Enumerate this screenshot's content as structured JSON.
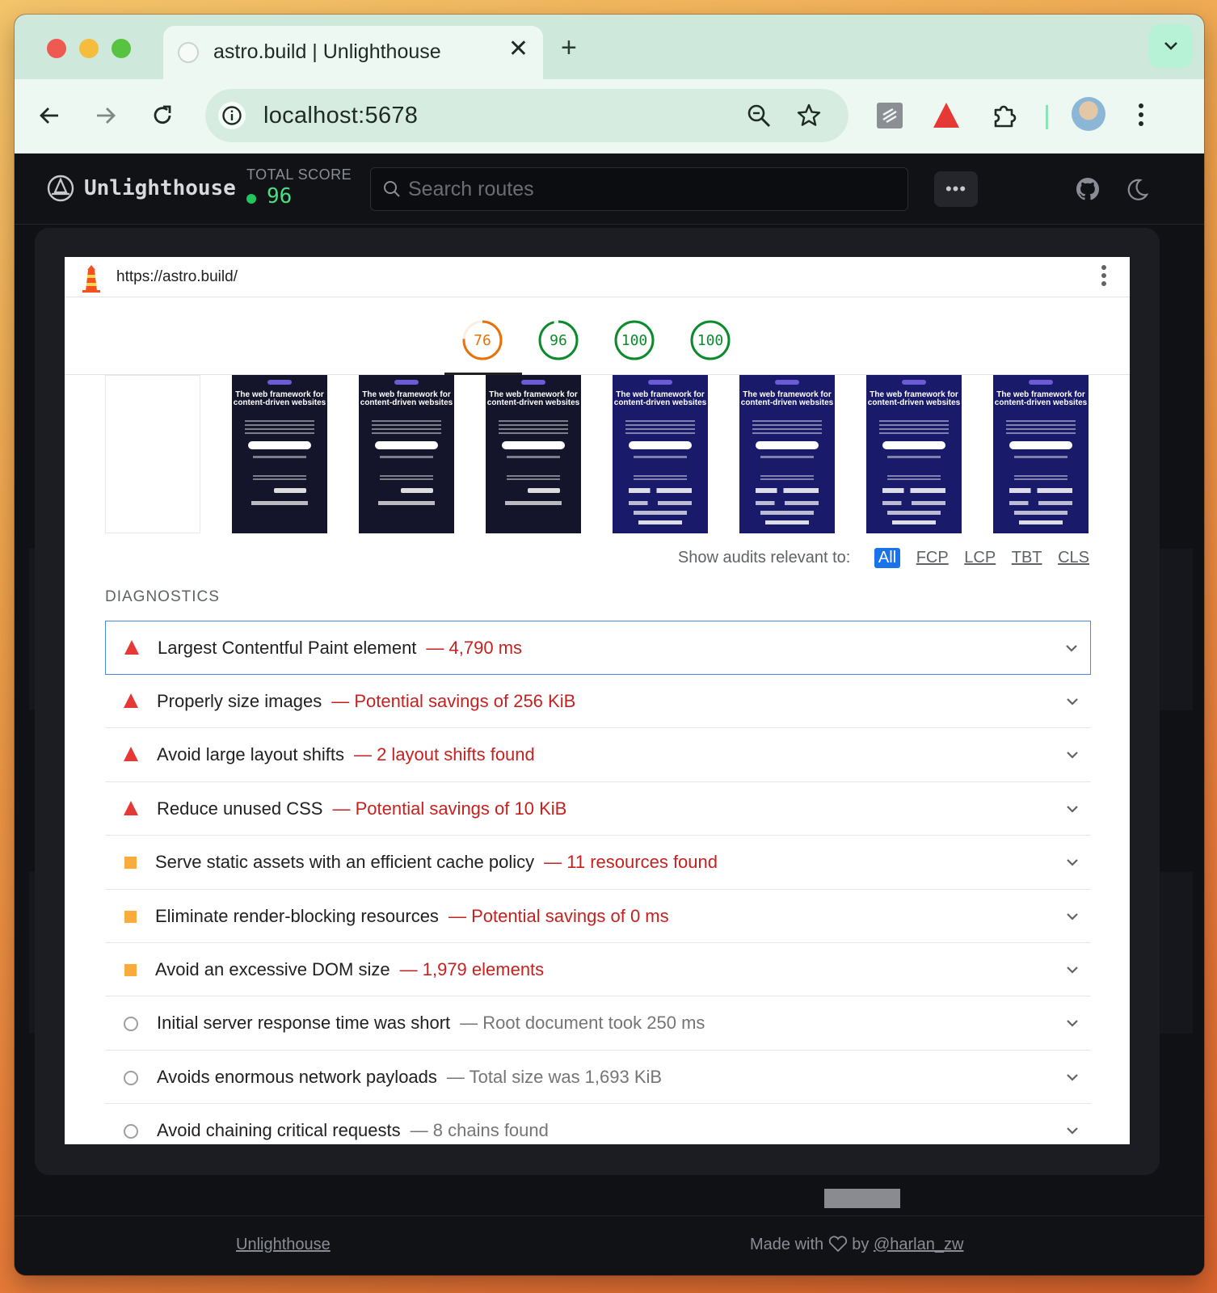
{
  "browser": {
    "tab_title": "astro.build | Unlighthouse",
    "close_glyph": "✕",
    "new_tab_glyph": "+",
    "url": "localhost:5678",
    "icons": [
      "back-icon",
      "forward-icon",
      "reload-icon",
      "info-icon",
      "zoom-icon",
      "bookmark-star-icon",
      "extension-icon",
      "lighthouse-extension-icon",
      "puzzle-icon",
      "profile-avatar",
      "menu-icon"
    ]
  },
  "app": {
    "brand": "Unlighthouse",
    "score_label": "TOTAL SCORE",
    "score_value": "96",
    "search_placeholder": "Search routes",
    "more_label": "•••"
  },
  "report": {
    "url": "https://astro.build/",
    "gauges": [
      {
        "value": "76",
        "color": "#e8710a",
        "fraction": 0.76
      },
      {
        "value": "96",
        "color": "#0c8a2c",
        "fraction": 0.96
      },
      {
        "value": "100",
        "color": "#0c8a2c",
        "fraction": 1.0
      },
      {
        "value": "100",
        "color": "#0c8a2c",
        "fraction": 1.0
      }
    ],
    "filmstrip": [
      {
        "state": "blank"
      },
      {
        "state": "dark",
        "headline": "The web framework for content-driven websites"
      },
      {
        "state": "dark",
        "headline": "The web framework for content-driven websites"
      },
      {
        "state": "dark",
        "headline": "The web framework for content-driven websites"
      },
      {
        "state": "purple",
        "headline": "The web framework for content-driven websites"
      },
      {
        "state": "purple",
        "headline": "The web framework for content-driven websites"
      },
      {
        "state": "purple",
        "headline": "The web framework for content-driven websites"
      },
      {
        "state": "purple",
        "headline": "The web framework for content-driven websites"
      }
    ],
    "relevant_label": "Show audits relevant to:",
    "filters": [
      "All",
      "FCP",
      "LCP",
      "TBT",
      "CLS"
    ],
    "active_filter": "All",
    "diagnostics_title": "DIAGNOSTICS",
    "audits": [
      {
        "title": "Largest Contentful Paint element",
        "detail": "4,790 ms",
        "status": "fail"
      },
      {
        "title": "Properly size images",
        "detail": "Potential savings of 256 KiB",
        "status": "fail"
      },
      {
        "title": "Avoid large layout shifts",
        "detail": "2 layout shifts found",
        "status": "fail"
      },
      {
        "title": "Reduce unused CSS",
        "detail": "Potential savings of 10 KiB",
        "status": "fail"
      },
      {
        "title": "Serve static assets with an efficient cache policy",
        "detail": "11 resources found",
        "status": "average"
      },
      {
        "title": "Eliminate render-blocking resources",
        "detail": "Potential savings of 0 ms",
        "status": "average"
      },
      {
        "title": "Avoid an excessive DOM size",
        "detail": "1,979 elements",
        "status": "average"
      },
      {
        "title": "Initial server response time was short",
        "detail": "Root document took 250 ms",
        "status": "info"
      },
      {
        "title": "Avoids enormous network payloads",
        "detail": "Total size was 1,693 KiB",
        "status": "info"
      },
      {
        "title": "Avoid chaining critical requests",
        "detail": "8 chains found",
        "status": "info"
      }
    ]
  },
  "footer": {
    "left_link": "Unlighthouse",
    "made_with": "Made with",
    "by": "by",
    "author": "@harlan_zw"
  },
  "colors": {
    "fail": "#c5221f",
    "fail_icon": "#e53935",
    "average_icon": "#f9ab3c",
    "info_icon": "#9e9e9e",
    "accent": "#1a73e8",
    "score_green": "#4ade80"
  }
}
